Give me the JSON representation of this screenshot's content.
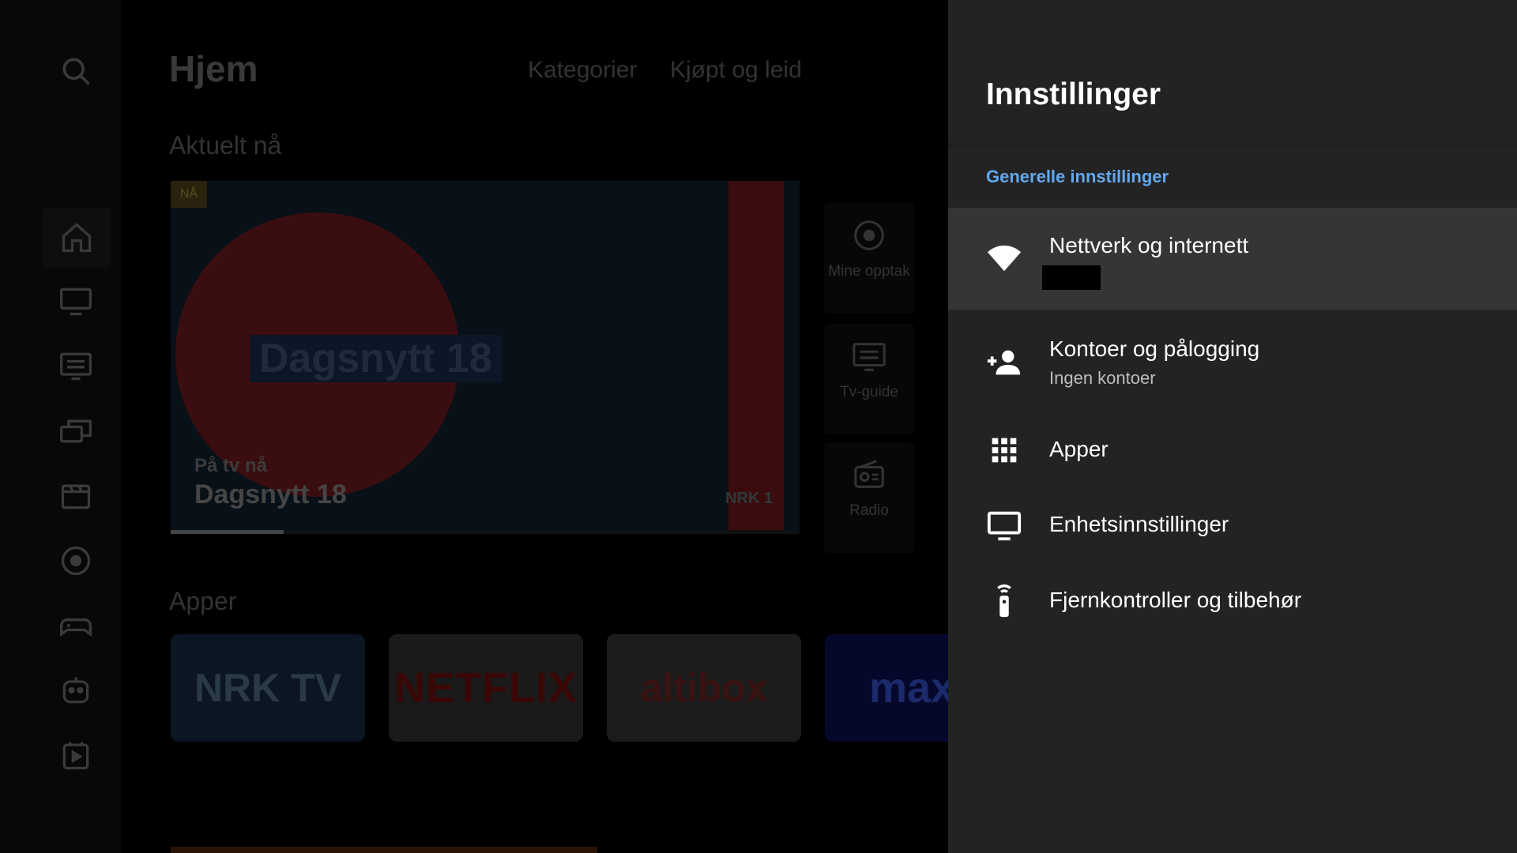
{
  "home": {
    "title": "Hjem",
    "tabs": [
      "Kategorier",
      "Kjøpt og leid"
    ],
    "sections": {
      "current": "Aktuelt nå",
      "apps": "Apper"
    },
    "hero": {
      "badge": "NÅ",
      "banner_text": "Dagsnytt 18",
      "on_tv_label": "På tv nå",
      "show_title": "Dagsnytt 18",
      "channel_logo": "NRK 1",
      "progress": 0.18
    },
    "quick_tiles": [
      {
        "label": "Mine opptak",
        "icon": "record-icon"
      },
      {
        "label": "Tv-guide",
        "icon": "tv-guide-icon"
      },
      {
        "label": "Radio",
        "icon": "radio-icon"
      }
    ],
    "app_tiles": [
      "NRK TV",
      "NETFLIX",
      "altibox",
      "max"
    ],
    "nav_icons": [
      "search-icon",
      "home-icon",
      "tv-icon",
      "guide-icon",
      "multiscreen-icon",
      "movie-icon",
      "record-icon",
      "gamepad-icon",
      "kids-icon",
      "play-store-icon"
    ]
  },
  "settings": {
    "title": "Innstillinger",
    "section_label": "Generelle innstillinger",
    "items": [
      {
        "title": "Nettverk og internett",
        "subtitle": "",
        "icon": "wifi-icon",
        "focused": true
      },
      {
        "title": "Kontoer og pålogging",
        "subtitle": "Ingen kontoer",
        "icon": "add-account-icon"
      },
      {
        "title": "Apper",
        "subtitle": "",
        "icon": "apps-grid-icon"
      },
      {
        "title": "Enhetsinnstillinger",
        "subtitle": "",
        "icon": "monitor-icon"
      },
      {
        "title": "Fjernkontroller og tilbehør",
        "subtitle": "",
        "icon": "remote-icon"
      }
    ],
    "accent_color": "#63a8ef",
    "panel_color": "#232323"
  }
}
